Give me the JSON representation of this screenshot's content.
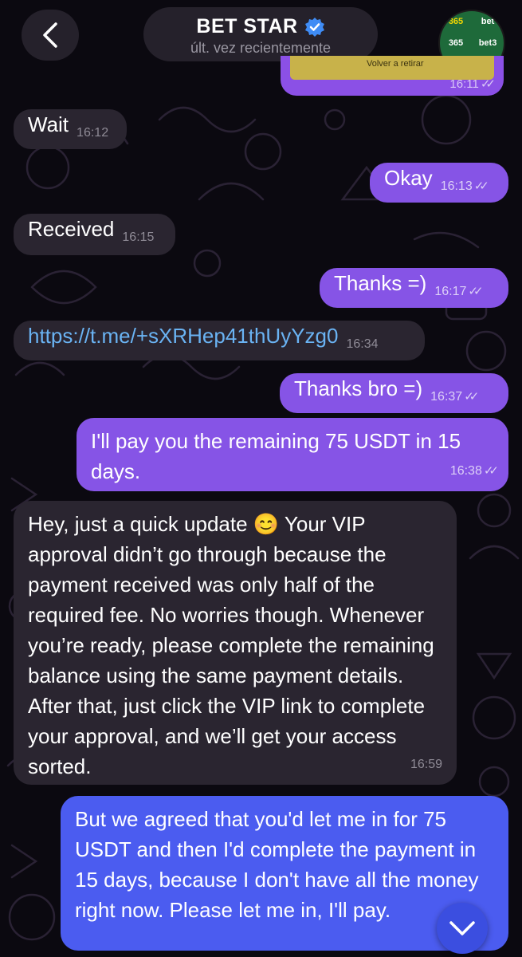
{
  "header": {
    "title": "BET STAR",
    "status": "últ. vez recientemente",
    "verified_icon": "verified-badge-icon",
    "back_icon": "chevron-left-icon"
  },
  "avatar": {
    "cells": [
      "365",
      "bet",
      "365",
      "bet3",
      "365",
      "bet"
    ]
  },
  "media_message": {
    "caption": "Volver a retirar",
    "time": "16:11"
  },
  "messages": [
    {
      "id": "m1",
      "direction": "in",
      "text": "Wait",
      "time": "16:12"
    },
    {
      "id": "m2",
      "direction": "out",
      "text": "Okay",
      "time": "16:13"
    },
    {
      "id": "m3",
      "direction": "in",
      "text": "Received",
      "time": "16:15"
    },
    {
      "id": "m4",
      "direction": "out",
      "text": "Thanks =)",
      "time": "16:17"
    },
    {
      "id": "m5",
      "direction": "in",
      "text": "https://t.me/+sXRHep41thUyYzg0",
      "time": "16:34"
    },
    {
      "id": "m6",
      "direction": "out",
      "text": "Thanks bro =)",
      "time": "16:37"
    },
    {
      "id": "m7",
      "direction": "out",
      "text": "I'll pay you the remaining 75 USDT in 15 days.",
      "time": "16:38"
    },
    {
      "id": "m8",
      "direction": "in",
      "text": "Hey, just a quick update 😊 Your VIP approval didn’t go through because the payment received was only half of the required fee. No worries though. Whenever you’re ready, please complete the remaining balance using the same payment details. After that, just click the VIP link to complete your approval, and we’ll get your access sorted.",
      "time": "16:59"
    },
    {
      "id": "m9",
      "direction": "out",
      "text": "But we agreed that you'd let me in for 75 USDT and then I'd complete the payment in 15 days, because I don't have all the money right now. Please let me in, I'll pay.",
      "time": ""
    }
  ],
  "read_checks": "✓✓",
  "scroll_down_icon": "chevron-down-icon",
  "colors": {
    "incoming": "#2a2530",
    "outgoing": "#8654e6",
    "outgoing_bottom": "#4b5cf0",
    "link": "#6ab3f3"
  }
}
